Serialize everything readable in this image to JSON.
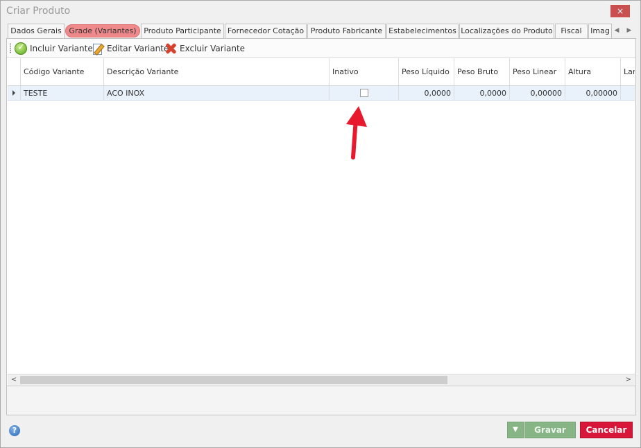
{
  "window": {
    "title": "Criar Produto",
    "close_icon": "×"
  },
  "tabs": [
    {
      "label": "Dados Gerais",
      "active": false
    },
    {
      "label": "Grade (Variantes)",
      "active": true
    },
    {
      "label": "Produto Participante",
      "active": false
    },
    {
      "label": "Fornecedor Cotação",
      "active": false
    },
    {
      "label": "Produto Fabricante",
      "active": false
    },
    {
      "label": "Estabelecimentos",
      "active": false
    },
    {
      "label": "Localizações do Produto",
      "active": false
    },
    {
      "label": "Fiscal",
      "active": false
    },
    {
      "label": "Imag",
      "active": false
    }
  ],
  "tab_scroll": {
    "left_icon": "◀",
    "right_icon": "▶"
  },
  "toolbar": {
    "add_label": "Incluir Variante",
    "edit_label": "Editar Variante",
    "delete_label": "Excluir Variante"
  },
  "grid": {
    "columns": [
      "Código Variante",
      "Descrição Variante",
      "Inativo",
      "Peso Líquido",
      "Peso Bruto",
      "Peso Linear",
      "Altura",
      "Larg"
    ],
    "rows": [
      {
        "codigo": "TESTE",
        "descricao": "ACO INOX",
        "inativo": false,
        "peso_liquido": "0,0000",
        "peso_bruto": "0,0000",
        "peso_linear": "0,00000",
        "altura": "0,00000",
        "largura": ""
      }
    ]
  },
  "scrollbar": {
    "left_icon": "<",
    "right_icon": ">"
  },
  "footer": {
    "help_icon": "?",
    "dropdown_icon": "▼",
    "save_label": "Gravar",
    "cancel_label": "Cancelar"
  },
  "colors": {
    "active_tab": "#f0898b",
    "save_button": "#87b586",
    "cancel_button": "#d8163a",
    "annotation_arrow": "#e8192c"
  }
}
